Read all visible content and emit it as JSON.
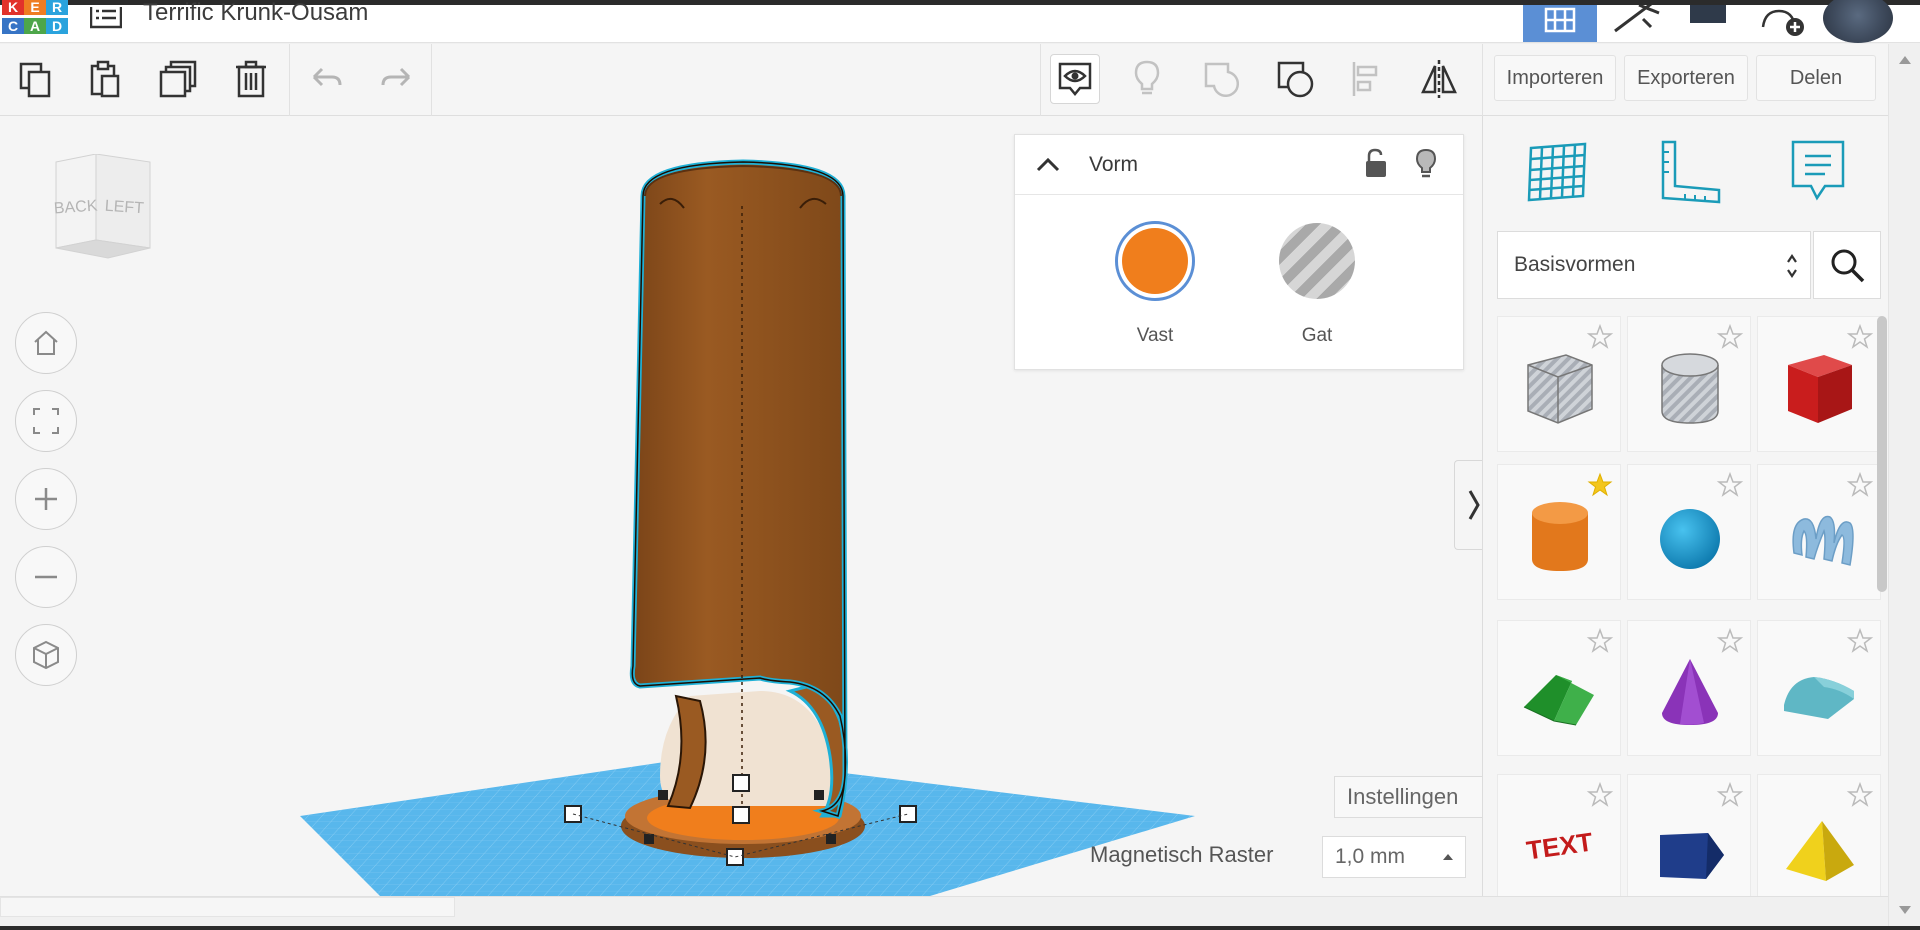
{
  "app": {
    "title": "Terrific Krunk-Ousam",
    "logo_letters": [
      "K",
      "E",
      "R",
      "C",
      "A",
      "D"
    ],
    "logo_colors": [
      "#e2322b",
      "#ef7d22",
      "#2aa3dd",
      "#3774c5",
      "#4da64a",
      "#2aa3dd"
    ]
  },
  "topbar": {
    "icons": [
      "list-icon",
      "grid-view-icon",
      "pickaxe-icon",
      "brick-icon",
      "add-person-icon",
      "avatar"
    ]
  },
  "toolbar": {
    "tools": [
      "copy-icon",
      "paste-icon",
      "duplicate-icon",
      "trash-icon",
      "undo-icon",
      "redo-icon"
    ],
    "view_tools": [
      "note-eye-icon",
      "bulb-icon",
      "shape-group-icon",
      "shape-subtract-icon",
      "align-icon",
      "mirror-icon"
    ],
    "import_label": "Importeren",
    "export_label": "Exporteren",
    "share_label": "Delen"
  },
  "viewcube": {
    "back": "BACK",
    "left": "LEFT"
  },
  "nav": {
    "buttons": [
      "home-icon",
      "fit-icon",
      "zoom-in-icon",
      "zoom-out-icon",
      "ortho-icon"
    ]
  },
  "inspector": {
    "title": "Vorm",
    "solid_label": "Vast",
    "hole_label": "Gat",
    "solid_color": "#f07e1c"
  },
  "settings": {
    "label": "Instellingen",
    "snap_label": "Magnetisch Raster",
    "snap_value": "1,0 mm"
  },
  "library": {
    "panel_icons": [
      "workplane-icon",
      "ruler-icon",
      "notes-icon"
    ],
    "category": "Basisvormen",
    "shapes": [
      {
        "name": "box-hole",
        "favorite": false
      },
      {
        "name": "cylinder-hole",
        "favorite": false
      },
      {
        "name": "box",
        "favorite": false
      },
      {
        "name": "cylinder",
        "favorite": true
      },
      {
        "name": "sphere",
        "favorite": false
      },
      {
        "name": "scribble",
        "favorite": false
      },
      {
        "name": "roof",
        "favorite": false
      },
      {
        "name": "cone",
        "favorite": false
      },
      {
        "name": "round-roof",
        "favorite": false
      },
      {
        "name": "text",
        "favorite": false
      },
      {
        "name": "prism",
        "favorite": false
      },
      {
        "name": "pyramid",
        "favorite": false
      }
    ],
    "text_tile_label": "TEXT"
  },
  "colors": {
    "accent": "#5b8fd5",
    "teal": "#1a9bb8",
    "grid": "#4db1e8",
    "object": "#8b5220"
  }
}
